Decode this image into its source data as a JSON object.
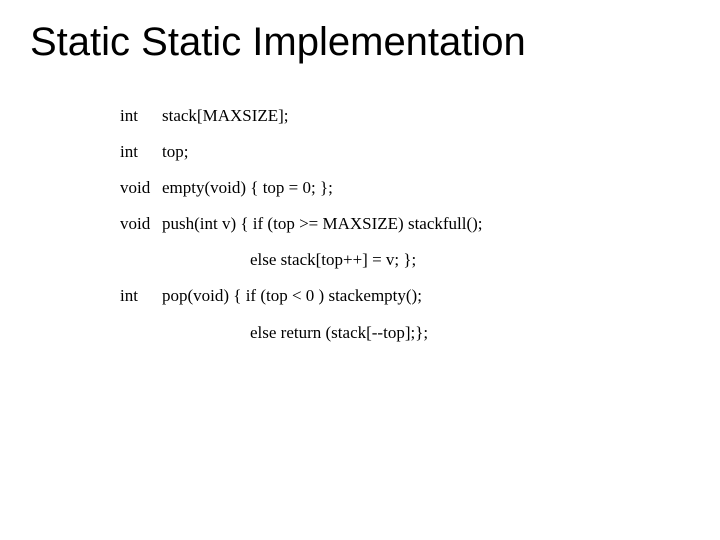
{
  "title": "Static Static Implementation",
  "lines": {
    "l1": {
      "kw": "int",
      "text": "stack[MAXSIZE];"
    },
    "l2": {
      "kw": "int",
      "text": "top;"
    },
    "l3": {
      "kw": "void",
      "text": "empty(void) { top = 0; };"
    },
    "l4": {
      "kw": "void",
      "text": "push(int v) { if (top >= MAXSIZE) stackfull();"
    },
    "l5": "else stack[top++] = v; };",
    "l6": {
      "kw": "int",
      "text": "pop(void)  { if (top < 0 )  stackempty();"
    },
    "l7": "else return (stack[--top];};"
  }
}
